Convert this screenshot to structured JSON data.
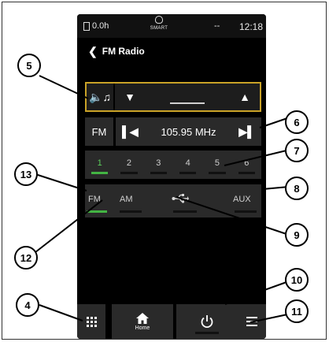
{
  "status_bar": {
    "trip": "0.0h",
    "center_label": "SMART",
    "dash": "--",
    "time": "12:18"
  },
  "title": "FM Radio",
  "source_row": {
    "source_icon": "speaker-music-icon",
    "tune_down_icon": "triangle-down-icon",
    "tune_up_icon": "triangle-up-icon"
  },
  "tuner": {
    "band": "FM",
    "frequency": "105.95 MHz",
    "seek_back_icon": "seek-back-icon",
    "seek_forward_icon": "seek-forward-icon"
  },
  "presets": [
    {
      "label": "1",
      "active": true
    },
    {
      "label": "2",
      "active": false
    },
    {
      "label": "3",
      "active": false
    },
    {
      "label": "4",
      "active": false
    },
    {
      "label": "5",
      "active": false
    },
    {
      "label": "6",
      "active": false
    }
  ],
  "sources": {
    "fm": "FM",
    "am": "AM",
    "usb_icon": "usb-icon",
    "aux": "AUX"
  },
  "bottom_bar": {
    "apps_icon": "apps-grid-icon",
    "home_label": "Home",
    "power_icon": "power-icon",
    "menu_icon": "menu-icon"
  },
  "callouts": {
    "c4": "4",
    "c5": "5",
    "c6": "6",
    "c7": "7",
    "c8": "8",
    "c9": "9",
    "c10": "10",
    "c11": "11",
    "c12": "12",
    "c13": "13"
  },
  "colors": {
    "frame_border": "#c9a227",
    "active_green": "#43b443",
    "panel_bg": "#2a2a2a",
    "screen_bg": "#000000"
  }
}
